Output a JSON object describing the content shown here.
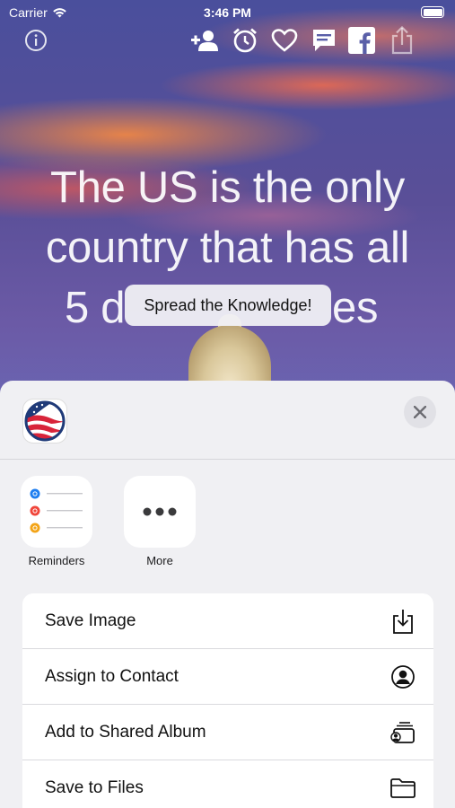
{
  "status_bar": {
    "carrier": "Carrier",
    "time": "3:46 PM"
  },
  "toolbar": {
    "icons": [
      "info-icon",
      "add-contact-icon",
      "alarm-icon",
      "heart-icon",
      "message-icon",
      "facebook-icon",
      "share-icon"
    ]
  },
  "fact": {
    "line1": "The US is the only",
    "line2": "country that has all",
    "line3": "5 d",
    "line3_end": "es"
  },
  "toast": {
    "text": "Spread the Knowledge!"
  },
  "share_sheet": {
    "apps": [
      {
        "label": "Reminders",
        "icon": "reminders-icon"
      },
      {
        "label": "More",
        "icon": "more-icon"
      }
    ],
    "actions": [
      {
        "label": "Save Image",
        "icon": "save-image-icon"
      },
      {
        "label": "Assign to Contact",
        "icon": "contact-icon"
      },
      {
        "label": "Add to Shared Album",
        "icon": "shared-album-icon"
      },
      {
        "label": "Save to Files",
        "icon": "folder-icon"
      }
    ]
  },
  "colors": {
    "sheet_bg": "#f0f0f3",
    "reminder_blue": "#1e7ef0",
    "reminder_red": "#f0453a",
    "reminder_orange": "#f3a417"
  }
}
